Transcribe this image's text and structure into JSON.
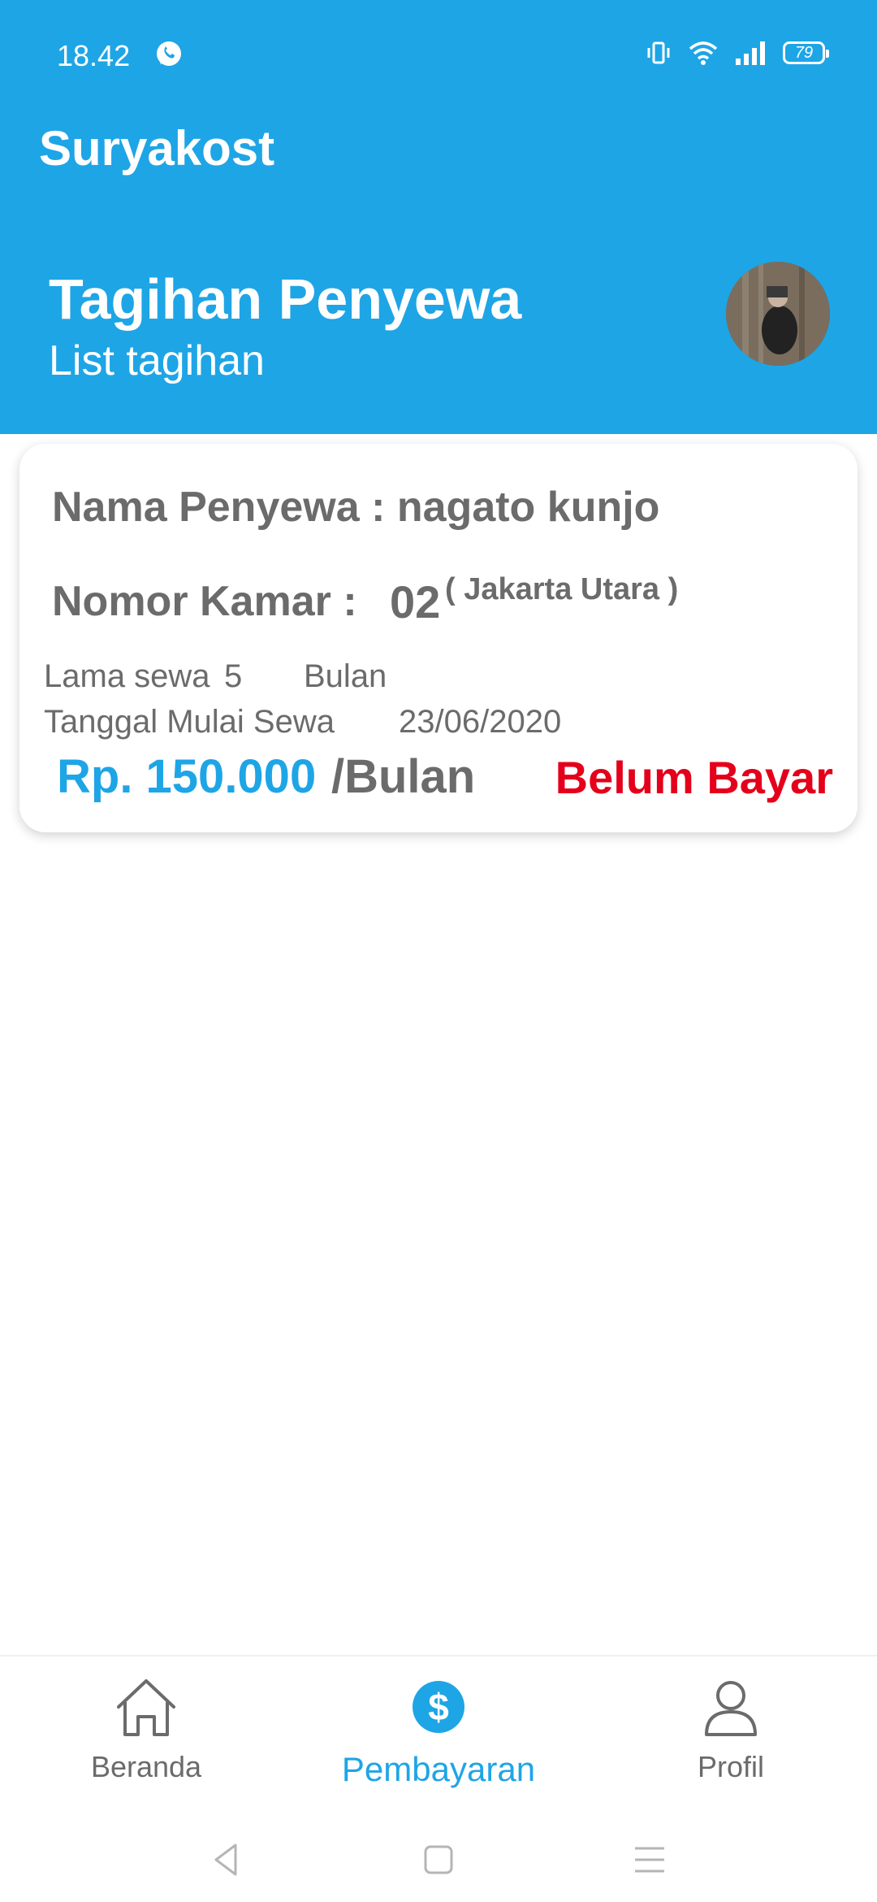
{
  "status_bar": {
    "time": "18.42",
    "battery": "79"
  },
  "app": {
    "title": "Suryakost"
  },
  "header": {
    "title": "Tagihan Penyewa",
    "subtitle": "List tagihan"
  },
  "bill": {
    "tenant_label": "Nama Penyewa :",
    "tenant_name": "nagato kunjo",
    "room_label": "Nomor Kamar :",
    "room_number": "02",
    "room_location": "( Jakarta Utara )",
    "duration_label": "Lama sewa",
    "duration_value": "5",
    "duration_unit": "Bulan",
    "start_label": "Tanggal Mulai Sewa",
    "start_date": "23/06/2020",
    "price": "Rp. 150.000",
    "price_unit": "/Bulan",
    "status": "Belum Bayar"
  },
  "nav": {
    "items": [
      {
        "label": "Beranda",
        "icon": "home-icon"
      },
      {
        "label": "Pembayaran",
        "icon": "dollar-icon"
      },
      {
        "label": "Profil",
        "icon": "user-icon"
      }
    ],
    "active": "Pembayaran"
  },
  "colors": {
    "primary": "#1ea5e6",
    "danger": "#e4001b",
    "text": "#6b6b6b"
  }
}
